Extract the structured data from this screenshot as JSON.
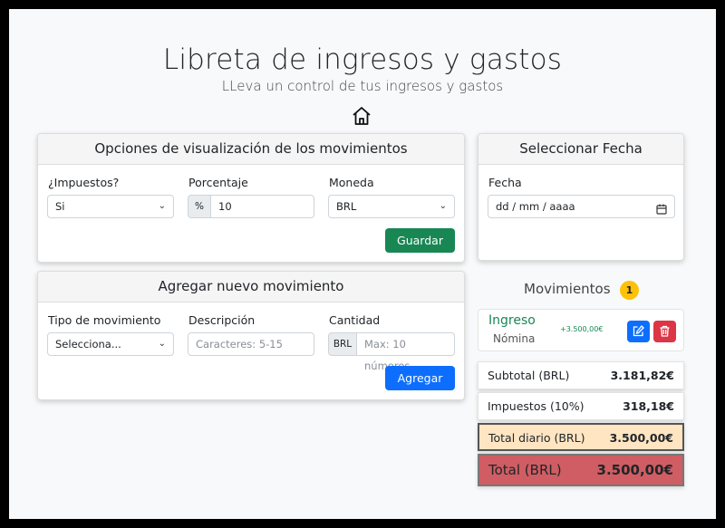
{
  "header": {
    "title": "Libreta de ingresos y gastos",
    "subtitle": "LLeva un control de tus ingresos y gastos",
    "home_icon": "home-icon"
  },
  "options_card": {
    "title": "Opciones de visualización de los movimientos",
    "taxes_label": "¿Impuestos?",
    "taxes_value": "Si",
    "percent_label": "Porcentaje",
    "percent_addon": "%",
    "percent_value": "10",
    "currency_label": "Moneda",
    "currency_value": "BRL",
    "save_label": "Guardar"
  },
  "date_card": {
    "title": "Seleccionar Fecha",
    "date_label": "Fecha",
    "date_placeholder": "dd / mm / aaaa",
    "calendar_icon": "calendar-icon"
  },
  "add_card": {
    "title": "Agregar nuevo movimiento",
    "type_label": "Tipo de movimiento",
    "type_value": "Selecciona...",
    "desc_label": "Descripción",
    "desc_placeholder": "Caracteres: 5-15",
    "qty_label": "Cantidad",
    "qty_addon": "BRL",
    "qty_placeholder": "Max: 10 números",
    "add_label": "Agregar"
  },
  "movements": {
    "title": "Movimientos",
    "count": "1",
    "items": [
      {
        "type": "Ingreso",
        "description": "Nómina",
        "amount": "+3.500,00€"
      }
    ]
  },
  "summary": {
    "subtotal_label": "Subtotal (BRL)",
    "subtotal_value": "3.181,82€",
    "taxes_label": "Impuestos (10%)",
    "taxes_value": "318,18€",
    "daily_label": "Total diario (BRL)",
    "daily_value": "3.500,00€",
    "total_label": "Total (BRL)",
    "total_value": "3.500,00€"
  },
  "colors": {
    "success": "#198754",
    "primary": "#0d6efd",
    "danger": "#dc3545",
    "badge": "#ffc107",
    "daily_bg": "#ffe5c2",
    "total_bg": "#cf5d63"
  }
}
